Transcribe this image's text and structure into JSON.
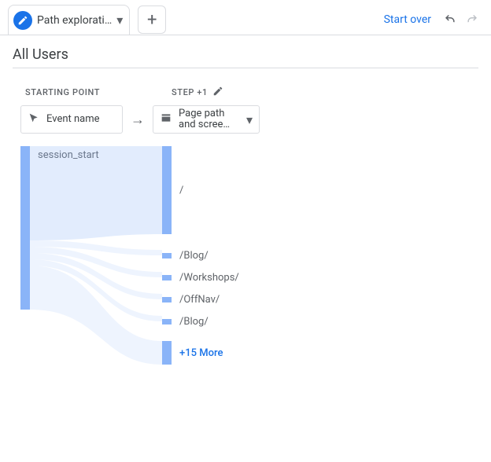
{
  "tab": {
    "title": "Path explorati…"
  },
  "actions": {
    "start_over": "Start over"
  },
  "segment": "All Users",
  "headers": {
    "start": "STARTING POINT",
    "step": "STEP +1"
  },
  "selectors": {
    "start_label": "Event name",
    "step_label": "Page path and scree…"
  },
  "sankey": {
    "source_label": "session_start",
    "dest": [
      {
        "label": "/"
      },
      {
        "label": "/Blog/"
      },
      {
        "label": "/Workshops/"
      },
      {
        "label": "/OffNav/"
      },
      {
        "label": "/Blog/"
      }
    ],
    "more_label": "+15 More"
  }
}
